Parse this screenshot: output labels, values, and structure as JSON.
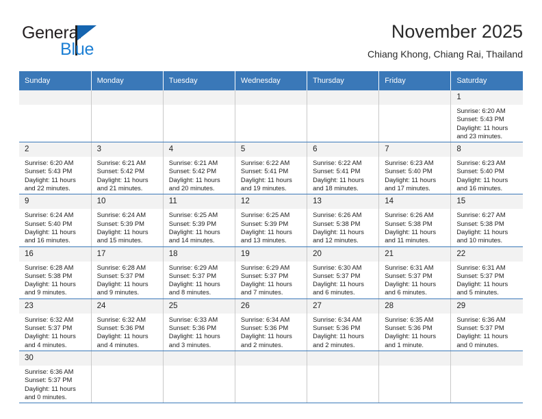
{
  "brand": {
    "name_primary": "General",
    "name_secondary": "Blue",
    "logo_icon": "triangle-flag-icon",
    "color_primary": "#231f20",
    "color_secondary": "#1c7fd4",
    "color_triangle": "#1565b0"
  },
  "header": {
    "title": "November 2025",
    "subtitle": "Chiang Khong, Chiang Rai, Thailand"
  },
  "theme": {
    "header_bg": "#3a78b8",
    "header_text": "#ffffff",
    "daynum_bg": "#f2f2f2",
    "row_divider": "#3a78b8",
    "col_divider": "#c8c8c8",
    "body_text": "#222222"
  },
  "columns": [
    "Sunday",
    "Monday",
    "Tuesday",
    "Wednesday",
    "Thursday",
    "Friday",
    "Saturday"
  ],
  "weeks": [
    [
      {
        "day": "",
        "blank": true,
        "sunrise": "",
        "sunset": "",
        "daylight_line1": "",
        "daylight_line2": ""
      },
      {
        "day": "",
        "blank": true,
        "sunrise": "",
        "sunset": "",
        "daylight_line1": "",
        "daylight_line2": ""
      },
      {
        "day": "",
        "blank": true,
        "sunrise": "",
        "sunset": "",
        "daylight_line1": "",
        "daylight_line2": ""
      },
      {
        "day": "",
        "blank": true,
        "sunrise": "",
        "sunset": "",
        "daylight_line1": "",
        "daylight_line2": ""
      },
      {
        "day": "",
        "blank": true,
        "sunrise": "",
        "sunset": "",
        "daylight_line1": "",
        "daylight_line2": ""
      },
      {
        "day": "",
        "blank": true,
        "sunrise": "",
        "sunset": "",
        "daylight_line1": "",
        "daylight_line2": ""
      },
      {
        "day": "1",
        "blank": false,
        "sunrise": "Sunrise: 6:20 AM",
        "sunset": "Sunset: 5:43 PM",
        "daylight_line1": "Daylight: 11 hours",
        "daylight_line2": "and 23 minutes."
      }
    ],
    [
      {
        "day": "2",
        "blank": false,
        "sunrise": "Sunrise: 6:20 AM",
        "sunset": "Sunset: 5:43 PM",
        "daylight_line1": "Daylight: 11 hours",
        "daylight_line2": "and 22 minutes."
      },
      {
        "day": "3",
        "blank": false,
        "sunrise": "Sunrise: 6:21 AM",
        "sunset": "Sunset: 5:42 PM",
        "daylight_line1": "Daylight: 11 hours",
        "daylight_line2": "and 21 minutes."
      },
      {
        "day": "4",
        "blank": false,
        "sunrise": "Sunrise: 6:21 AM",
        "sunset": "Sunset: 5:42 PM",
        "daylight_line1": "Daylight: 11 hours",
        "daylight_line2": "and 20 minutes."
      },
      {
        "day": "5",
        "blank": false,
        "sunrise": "Sunrise: 6:22 AM",
        "sunset": "Sunset: 5:41 PM",
        "daylight_line1": "Daylight: 11 hours",
        "daylight_line2": "and 19 minutes."
      },
      {
        "day": "6",
        "blank": false,
        "sunrise": "Sunrise: 6:22 AM",
        "sunset": "Sunset: 5:41 PM",
        "daylight_line1": "Daylight: 11 hours",
        "daylight_line2": "and 18 minutes."
      },
      {
        "day": "7",
        "blank": false,
        "sunrise": "Sunrise: 6:23 AM",
        "sunset": "Sunset: 5:40 PM",
        "daylight_line1": "Daylight: 11 hours",
        "daylight_line2": "and 17 minutes."
      },
      {
        "day": "8",
        "blank": false,
        "sunrise": "Sunrise: 6:23 AM",
        "sunset": "Sunset: 5:40 PM",
        "daylight_line1": "Daylight: 11 hours",
        "daylight_line2": "and 16 minutes."
      }
    ],
    [
      {
        "day": "9",
        "blank": false,
        "sunrise": "Sunrise: 6:24 AM",
        "sunset": "Sunset: 5:40 PM",
        "daylight_line1": "Daylight: 11 hours",
        "daylight_line2": "and 16 minutes."
      },
      {
        "day": "10",
        "blank": false,
        "sunrise": "Sunrise: 6:24 AM",
        "sunset": "Sunset: 5:39 PM",
        "daylight_line1": "Daylight: 11 hours",
        "daylight_line2": "and 15 minutes."
      },
      {
        "day": "11",
        "blank": false,
        "sunrise": "Sunrise: 6:25 AM",
        "sunset": "Sunset: 5:39 PM",
        "daylight_line1": "Daylight: 11 hours",
        "daylight_line2": "and 14 minutes."
      },
      {
        "day": "12",
        "blank": false,
        "sunrise": "Sunrise: 6:25 AM",
        "sunset": "Sunset: 5:39 PM",
        "daylight_line1": "Daylight: 11 hours",
        "daylight_line2": "and 13 minutes."
      },
      {
        "day": "13",
        "blank": false,
        "sunrise": "Sunrise: 6:26 AM",
        "sunset": "Sunset: 5:38 PM",
        "daylight_line1": "Daylight: 11 hours",
        "daylight_line2": "and 12 minutes."
      },
      {
        "day": "14",
        "blank": false,
        "sunrise": "Sunrise: 6:26 AM",
        "sunset": "Sunset: 5:38 PM",
        "daylight_line1": "Daylight: 11 hours",
        "daylight_line2": "and 11 minutes."
      },
      {
        "day": "15",
        "blank": false,
        "sunrise": "Sunrise: 6:27 AM",
        "sunset": "Sunset: 5:38 PM",
        "daylight_line1": "Daylight: 11 hours",
        "daylight_line2": "and 10 minutes."
      }
    ],
    [
      {
        "day": "16",
        "blank": false,
        "sunrise": "Sunrise: 6:28 AM",
        "sunset": "Sunset: 5:38 PM",
        "daylight_line1": "Daylight: 11 hours",
        "daylight_line2": "and 9 minutes."
      },
      {
        "day": "17",
        "blank": false,
        "sunrise": "Sunrise: 6:28 AM",
        "sunset": "Sunset: 5:37 PM",
        "daylight_line1": "Daylight: 11 hours",
        "daylight_line2": "and 9 minutes."
      },
      {
        "day": "18",
        "blank": false,
        "sunrise": "Sunrise: 6:29 AM",
        "sunset": "Sunset: 5:37 PM",
        "daylight_line1": "Daylight: 11 hours",
        "daylight_line2": "and 8 minutes."
      },
      {
        "day": "19",
        "blank": false,
        "sunrise": "Sunrise: 6:29 AM",
        "sunset": "Sunset: 5:37 PM",
        "daylight_line1": "Daylight: 11 hours",
        "daylight_line2": "and 7 minutes."
      },
      {
        "day": "20",
        "blank": false,
        "sunrise": "Sunrise: 6:30 AM",
        "sunset": "Sunset: 5:37 PM",
        "daylight_line1": "Daylight: 11 hours",
        "daylight_line2": "and 6 minutes."
      },
      {
        "day": "21",
        "blank": false,
        "sunrise": "Sunrise: 6:31 AM",
        "sunset": "Sunset: 5:37 PM",
        "daylight_line1": "Daylight: 11 hours",
        "daylight_line2": "and 6 minutes."
      },
      {
        "day": "22",
        "blank": false,
        "sunrise": "Sunrise: 6:31 AM",
        "sunset": "Sunset: 5:37 PM",
        "daylight_line1": "Daylight: 11 hours",
        "daylight_line2": "and 5 minutes."
      }
    ],
    [
      {
        "day": "23",
        "blank": false,
        "sunrise": "Sunrise: 6:32 AM",
        "sunset": "Sunset: 5:37 PM",
        "daylight_line1": "Daylight: 11 hours",
        "daylight_line2": "and 4 minutes."
      },
      {
        "day": "24",
        "blank": false,
        "sunrise": "Sunrise: 6:32 AM",
        "sunset": "Sunset: 5:36 PM",
        "daylight_line1": "Daylight: 11 hours",
        "daylight_line2": "and 4 minutes."
      },
      {
        "day": "25",
        "blank": false,
        "sunrise": "Sunrise: 6:33 AM",
        "sunset": "Sunset: 5:36 PM",
        "daylight_line1": "Daylight: 11 hours",
        "daylight_line2": "and 3 minutes."
      },
      {
        "day": "26",
        "blank": false,
        "sunrise": "Sunrise: 6:34 AM",
        "sunset": "Sunset: 5:36 PM",
        "daylight_line1": "Daylight: 11 hours",
        "daylight_line2": "and 2 minutes."
      },
      {
        "day": "27",
        "blank": false,
        "sunrise": "Sunrise: 6:34 AM",
        "sunset": "Sunset: 5:36 PM",
        "daylight_line1": "Daylight: 11 hours",
        "daylight_line2": "and 2 minutes."
      },
      {
        "day": "28",
        "blank": false,
        "sunrise": "Sunrise: 6:35 AM",
        "sunset": "Sunset: 5:36 PM",
        "daylight_line1": "Daylight: 11 hours",
        "daylight_line2": "and 1 minute."
      },
      {
        "day": "29",
        "blank": false,
        "sunrise": "Sunrise: 6:36 AM",
        "sunset": "Sunset: 5:37 PM",
        "daylight_line1": "Daylight: 11 hours",
        "daylight_line2": "and 0 minutes."
      }
    ],
    [
      {
        "day": "30",
        "blank": false,
        "sunrise": "Sunrise: 6:36 AM",
        "sunset": "Sunset: 5:37 PM",
        "daylight_line1": "Daylight: 11 hours",
        "daylight_line2": "and 0 minutes."
      },
      {
        "day": "",
        "blank": true,
        "sunrise": "",
        "sunset": "",
        "daylight_line1": "",
        "daylight_line2": ""
      },
      {
        "day": "",
        "blank": true,
        "sunrise": "",
        "sunset": "",
        "daylight_line1": "",
        "daylight_line2": ""
      },
      {
        "day": "",
        "blank": true,
        "sunrise": "",
        "sunset": "",
        "daylight_line1": "",
        "daylight_line2": ""
      },
      {
        "day": "",
        "blank": true,
        "sunrise": "",
        "sunset": "",
        "daylight_line1": "",
        "daylight_line2": ""
      },
      {
        "day": "",
        "blank": true,
        "sunrise": "",
        "sunset": "",
        "daylight_line1": "",
        "daylight_line2": ""
      },
      {
        "day": "",
        "blank": true,
        "sunrise": "",
        "sunset": "",
        "daylight_line1": "",
        "daylight_line2": ""
      }
    ]
  ]
}
